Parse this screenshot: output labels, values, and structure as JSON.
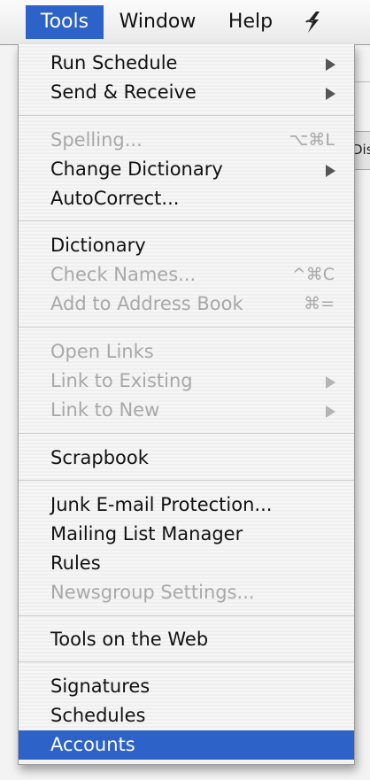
{
  "menubar": {
    "items": [
      {
        "label": "Tools"
      },
      {
        "label": "Window"
      },
      {
        "label": "Help"
      }
    ],
    "script_icon": "script-menu-icon"
  },
  "background": {
    "tab_text": "Dis"
  },
  "menu": {
    "items": [
      {
        "label": "Run Schedule",
        "shortcut": "",
        "submenu": true,
        "enabled": true
      },
      {
        "label": "Send & Receive",
        "shortcut": "",
        "submenu": true,
        "enabled": true
      },
      {
        "label": "Spelling...",
        "shortcut": "⌥⌘L",
        "submenu": false,
        "enabled": false
      },
      {
        "label": "Change Dictionary",
        "shortcut": "",
        "submenu": true,
        "enabled": true
      },
      {
        "label": "AutoCorrect...",
        "shortcut": "",
        "submenu": false,
        "enabled": true
      },
      {
        "label": "Dictionary",
        "shortcut": "",
        "submenu": false,
        "enabled": true
      },
      {
        "label": "Check Names...",
        "shortcut": "^⌘C",
        "submenu": false,
        "enabled": false
      },
      {
        "label": "Add to Address Book",
        "shortcut": "⌘=",
        "submenu": false,
        "enabled": false
      },
      {
        "label": "Open Links",
        "shortcut": "",
        "submenu": false,
        "enabled": false
      },
      {
        "label": "Link to Existing",
        "shortcut": "",
        "submenu": true,
        "enabled": false
      },
      {
        "label": "Link to New",
        "shortcut": "",
        "submenu": true,
        "enabled": false
      },
      {
        "label": "Scrapbook",
        "shortcut": "",
        "submenu": false,
        "enabled": true
      },
      {
        "label": "Junk E-mail Protection...",
        "shortcut": "",
        "submenu": false,
        "enabled": true
      },
      {
        "label": "Mailing List Manager",
        "shortcut": "",
        "submenu": false,
        "enabled": true
      },
      {
        "label": "Rules",
        "shortcut": "",
        "submenu": false,
        "enabled": true
      },
      {
        "label": "Newsgroup Settings...",
        "shortcut": "",
        "submenu": false,
        "enabled": false
      },
      {
        "label": "Tools on the Web",
        "shortcut": "",
        "submenu": false,
        "enabled": true
      },
      {
        "label": "Signatures",
        "shortcut": "",
        "submenu": false,
        "enabled": true
      },
      {
        "label": "Schedules",
        "shortcut": "",
        "submenu": false,
        "enabled": true
      },
      {
        "label": "Accounts",
        "shortcut": "",
        "submenu": false,
        "enabled": true,
        "highlighted": true
      }
    ]
  },
  "colors": {
    "highlight": "#2d62c8",
    "disabled_text": "#a8a8a8"
  }
}
